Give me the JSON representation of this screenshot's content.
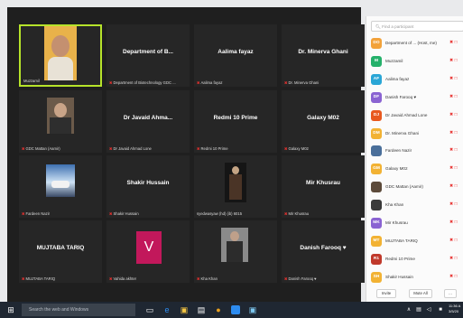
{
  "gallery": {
    "tiles": [
      {
        "display_name": "",
        "label": "Muzzamil",
        "muted": false,
        "has_video": true
      },
      {
        "display_name": "Department of B...",
        "label": "Department of Biotechnology GDC ...",
        "muted": true,
        "has_video": false
      },
      {
        "display_name": "Aalima fayaz",
        "label": "Aalima fayaz",
        "muted": true,
        "has_video": false
      },
      {
        "display_name": "Dr. Minerva Ghani",
        "label": "Dr. Minerva Ghani",
        "muted": true,
        "has_video": false
      },
      {
        "display_name": "",
        "label": "GDC Mattan (Aamir)",
        "muted": true,
        "has_video": true
      },
      {
        "display_name": "Dr Javaid Ahma...",
        "label": "Dr Javaid Ahmad Lone",
        "muted": true,
        "has_video": false
      },
      {
        "display_name": "Redmi 10 Prime",
        "label": "Redmi 10 Prime",
        "muted": true,
        "has_video": false
      },
      {
        "display_name": "Galaxy M02",
        "label": "Galaxy M02",
        "muted": true,
        "has_video": false
      },
      {
        "display_name": "",
        "label": "Fardeen Nazir",
        "muted": true,
        "has_video": true
      },
      {
        "display_name": "Shakir Hussain",
        "label": "Shakir Hussain",
        "muted": true,
        "has_video": false
      },
      {
        "display_name": "",
        "label": "syedwasyaw (hd) (ib) 6015",
        "muted": false,
        "has_video": true
      },
      {
        "display_name": "Mir Khusrau",
        "label": "Mir Khusrau",
        "muted": true,
        "has_video": false
      },
      {
        "display_name": "MUJTABA TARIQ",
        "label": "MUJTABA TARIQ",
        "muted": true,
        "has_video": false
      },
      {
        "display_name": "V",
        "label": "Vahida akhter",
        "muted": true,
        "has_video": false
      },
      {
        "display_name": "",
        "label": "Kha Khan",
        "muted": true,
        "has_video": true
      },
      {
        "display_name": "Danish Farooq ♥",
        "label": "Danish Farooq ♥",
        "muted": true,
        "has_video": false
      }
    ]
  },
  "participants": {
    "search_placeholder": "Find a participant",
    "items": [
      {
        "avatar": "DO",
        "color": "#f2a23a",
        "name": "Department of ... (Host, me)",
        "icons": "✖ □"
      },
      {
        "avatar": "M",
        "color": "#25b16b",
        "name": "Muzzamil",
        "icons": "✖ □"
      },
      {
        "avatar": "AF",
        "color": "#2aa6d6",
        "name": "Aalima fayaz",
        "icons": "✖ □"
      },
      {
        "avatar": "DF",
        "color": "#8a63d2",
        "name": "Danish Farooq ♥",
        "icons": "✖ □"
      },
      {
        "avatar": "DJ",
        "color": "#e8591f",
        "name": "Dr Javaid Ahmad Lone",
        "icons": "✖ □"
      },
      {
        "avatar": "DM",
        "color": "#f2b233",
        "name": "Dr. Minerva Ghani",
        "icons": "✖ □"
      },
      {
        "avatar": "",
        "color": "#4a6f9a",
        "name": "Fardeen Nazir",
        "icons": "✖ □"
      },
      {
        "avatar": "GM",
        "color": "#f2b233",
        "name": "Galaxy M02",
        "icons": "✖ □"
      },
      {
        "avatar": "",
        "color": "#5c4a3a",
        "name": "GDC Mattan (Aamir)",
        "icons": "✖ □"
      },
      {
        "avatar": "",
        "color": "#3a3a3a",
        "name": "Kha Khan",
        "icons": "✖ □"
      },
      {
        "avatar": "MK",
        "color": "#8a63d2",
        "name": "Mir Khusrau",
        "icons": "✖ □"
      },
      {
        "avatar": "MT",
        "color": "#f2b233",
        "name": "MUJTABA TARIQ",
        "icons": "✖ □"
      },
      {
        "avatar": "R1",
        "color": "#c0392b",
        "name": "Redmi 10 Prime",
        "icons": "✖ □"
      },
      {
        "avatar": "SH",
        "color": "#f2b233",
        "name": "Shakir Hussain",
        "icons": "✖ □"
      }
    ],
    "invite_label": "Invite",
    "mute_all_label": "Mute All",
    "more_label": "..."
  },
  "taskbar": {
    "search_placeholder": "Search the web and Windows",
    "clock_time": "11:36 A",
    "clock_date": "3/5/20"
  },
  "colors": {
    "active_speaker_border": "#b6e32a",
    "muted_icon": "#e8312f",
    "vahida_avatar": "#c2185b"
  }
}
